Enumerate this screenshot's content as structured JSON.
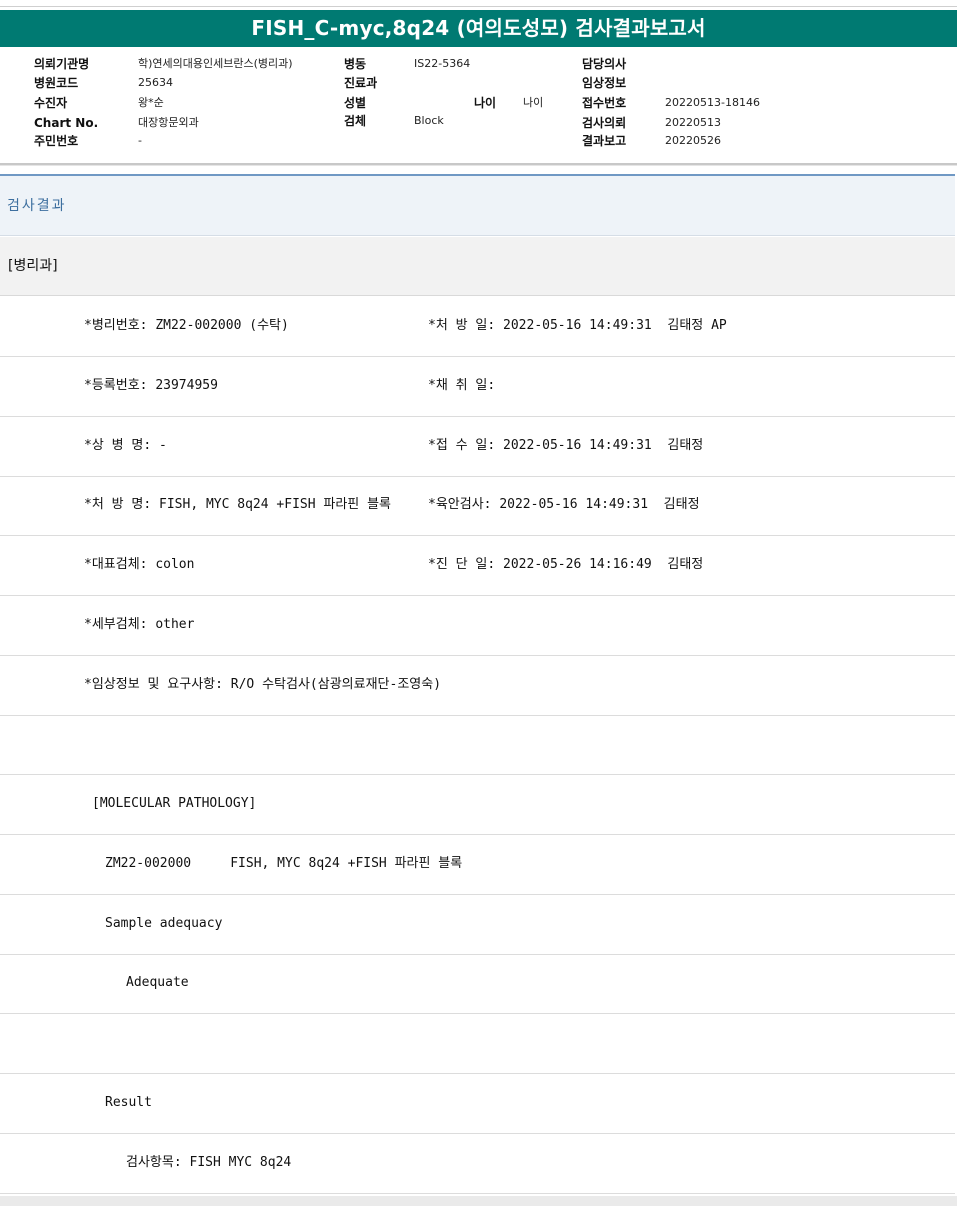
{
  "report": {
    "title": "FISH_C-myc,8q24 (여의도성모) 검사결과보고서"
  },
  "header": {
    "col1": [
      {
        "label": "의뢰기관명",
        "value": "학)연세의대용인세브란스(병리과)"
      },
      {
        "label": "병원코드",
        "value": "25634"
      },
      {
        "label": "수진자",
        "value": "왕*순"
      },
      {
        "label": "Chart No.",
        "value": "대장항문외과"
      },
      {
        "label": "주민번호",
        "value": "-"
      }
    ],
    "col2": [
      {
        "label": "병동",
        "value": "IS22-5364"
      },
      {
        "label": "진료과",
        "value": ""
      },
      {
        "label": "성별",
        "value": ""
      },
      {
        "label": "검체",
        "value": "Block"
      }
    ],
    "age": {
      "label": "나이",
      "value": "나이"
    },
    "col3": [
      {
        "label": "담당의사",
        "value": ""
      },
      {
        "label": "임상정보",
        "value": ""
      },
      {
        "label": "접수번호",
        "value": "20220513-18146"
      },
      {
        "label": "검사의뢰",
        "value": "20220513"
      },
      {
        "label": "결과보고",
        "value": "20220526"
      }
    ]
  },
  "results": {
    "section_title": "검사결과",
    "department": "[병리과]",
    "rows": [
      {
        "left": "*병리번호: ZM22-002000 (수탁)",
        "right": "*처 방 일: 2022-05-16 14:49:31  김태정 AP"
      },
      {
        "left": "*등록번호: 23974959",
        "right": "*채 취 일:"
      },
      {
        "left": "*상 병 명: -",
        "right": "*접 수 일: 2022-05-16 14:49:31  김태정"
      },
      {
        "left": "*처 방 명: FISH, MYC 8q24 +FISH 파라핀 블록",
        "right": "*육안검사: 2022-05-16 14:49:31  김태정"
      },
      {
        "left": "*대표검체: colon",
        "right": "*진 단 일: 2022-05-26 14:16:49  김태정"
      },
      {
        "left": "*세부검체: other",
        "right": ""
      },
      {
        "left": "*임상정보 및 요구사항: R/O 수탁검사(삼광의료재단-조영숙)",
        "right": ""
      },
      {
        "left": "",
        "right": ""
      },
      {
        "left": "[MOLECULAR PATHOLOGY]",
        "right": ""
      },
      {
        "left": "ZM22-002000     FISH, MYC 8q24 +FISH 파라핀 블록",
        "right": ""
      },
      {
        "left": "Sample adequacy",
        "right": ""
      },
      {
        "left": "Adequate",
        "right": ""
      },
      {
        "left": "",
        "right": ""
      },
      {
        "left": "Result",
        "right": ""
      },
      {
        "left": "검사항목: FISH MYC 8q24",
        "right": ""
      }
    ]
  }
}
